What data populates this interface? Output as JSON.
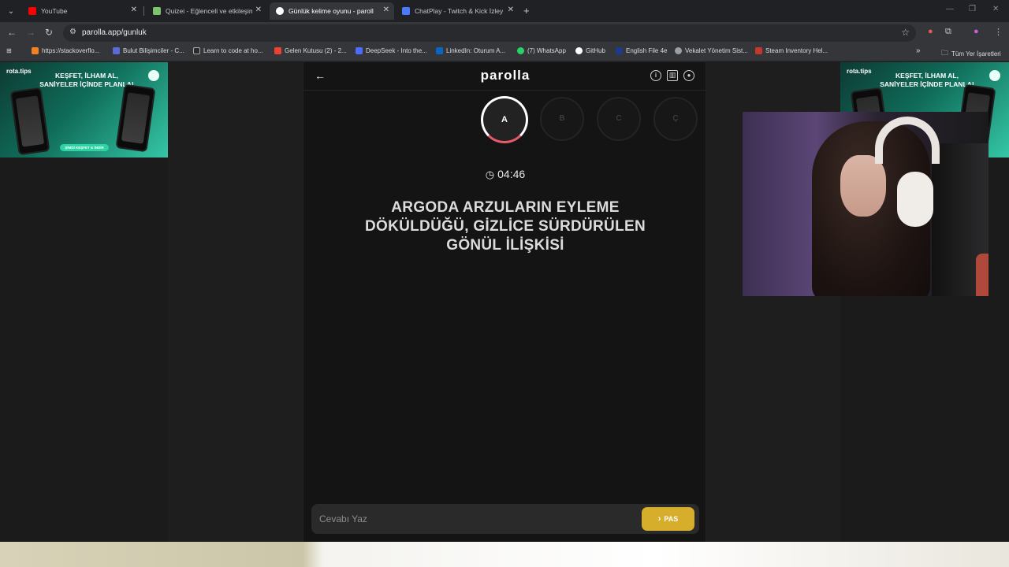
{
  "tabs": [
    {
      "title": "YouTube",
      "favicon_color": "#ff0000"
    },
    {
      "title": "Quizei - Eğlenceli ve etkileşimli",
      "favicon_color": "#7cc36f"
    },
    {
      "title": "Günlük kelime oyunu - parolla",
      "favicon_color": "#ffffff"
    },
    {
      "title": "ChatPlay - Twitch & Kick İzleyici",
      "favicon_color": "#4a7bff"
    }
  ],
  "toolbar": {
    "url": "parolla.app/gunluk"
  },
  "bookmarks": [
    {
      "label": "https://stackoverflo...",
      "color": "#f48024"
    },
    {
      "label": "Bulut Bilişimciler - C...",
      "color": "#5a6bd6"
    },
    {
      "label": "Learn to code at ho...",
      "color": "#2b2b2b"
    },
    {
      "label": "Gelen Kutusu (2) - 2...",
      "color": "#ea4335"
    },
    {
      "label": "DeepSeek - Into the...",
      "color": "#4d6bfe"
    },
    {
      "label": "LinkedIn: Oturum A...",
      "color": "#0a66c2"
    },
    {
      "label": "(7) WhatsApp",
      "color": "#25d366"
    },
    {
      "label": "GitHub",
      "color": "#ffffff"
    },
    {
      "label": "English File 4e",
      "color": "#1e3a8a"
    },
    {
      "label": "Vekalet Yönetim Sist...",
      "color": "#9aa0a6"
    },
    {
      "label": "Steam Inventory Hel...",
      "color": "#c0392b"
    }
  ],
  "bookmarks_more": "»",
  "all_bookmarks": "Tüm Yer İşaretleri",
  "ads": {
    "brand": "rota.tips",
    "headline_line1": "KEŞFET, İLHAM AL,",
    "headline_line2": "SANİYELER İÇİNDE PLANLA!",
    "cta": "ŞİMDİ KEŞFET & İNDİR"
  },
  "game": {
    "logo": "parolla",
    "letters": [
      {
        "letter": "A",
        "active": true
      },
      {
        "letter": "B",
        "active": false
      },
      {
        "letter": "C",
        "active": false
      },
      {
        "letter": "Ç",
        "active": false
      }
    ],
    "timer": "04:46",
    "clue_line1": "ARGODA ARZULARIN EYLEME",
    "clue_line2": "DÖKÜLDÜĞÜ, GİZLİCE SÜRDÜRÜLEN",
    "clue_line3": "GÖNÜL İLİŞKİSİ",
    "answer_placeholder": "Cevabı Yaz",
    "pass_label": "PAS",
    "accent_color": "#d6ae2b"
  }
}
